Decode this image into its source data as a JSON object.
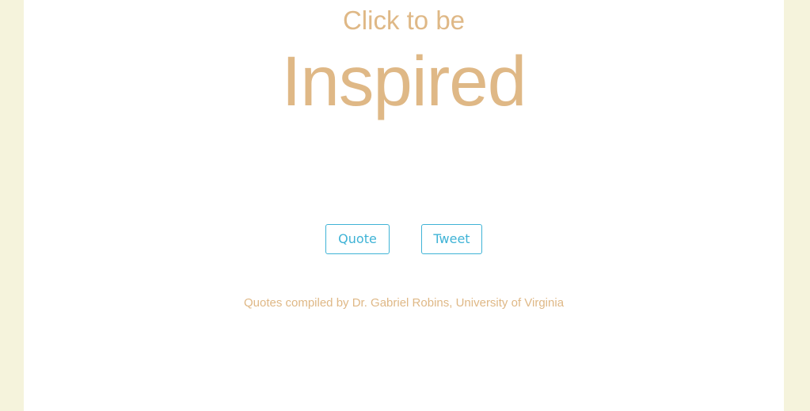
{
  "header": {
    "subtitle": "Click to be",
    "title": "Inspired"
  },
  "actions": {
    "quote_label": "Quote",
    "tweet_label": "Tweet"
  },
  "footer": {
    "credit": "Quotes compiled by Dr. Gabriel Robins, University of Virginia"
  },
  "colors": {
    "background": "#f5f3dc",
    "panel": "#ffffff",
    "accent_text": "#dfb886",
    "button": "#3fb3d6"
  }
}
